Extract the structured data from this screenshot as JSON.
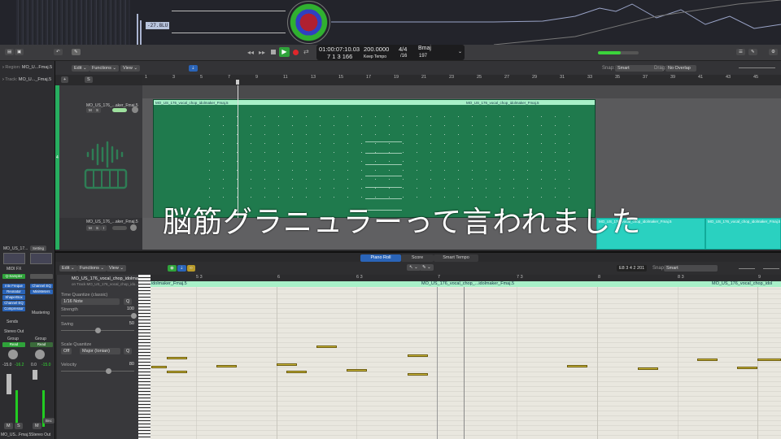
{
  "visualizer": {
    "loudness": "-27.8LU"
  },
  "transport": {
    "rewind": "rewind",
    "forward": "fast-forward",
    "stop": "stop",
    "play": "play",
    "record": "record",
    "cycle": "cycle"
  },
  "lcd": {
    "time": "01:00:07:10.03",
    "bars": "7  1  3  166",
    "tempo": "200.0000",
    "tempo_mode": "Keep Tempo",
    "signature": "4/4",
    "division": "/16",
    "key": "Bmaj",
    "key_value": "197"
  },
  "inspector": {
    "region_label": "Region:",
    "region_name": "MO_U...Fmaj.5",
    "track_label": "Track:",
    "track_name": "MO_U..._Fmaj.5"
  },
  "tracks_toolbar": {
    "edit": "Edit",
    "functions": "Functions",
    "view": "View",
    "snap_label": "Snap:",
    "snap_value": "Smart",
    "drag_label": "Drag:",
    "drag_value": "No Overlap",
    "add": "+",
    "s": "S"
  },
  "ruler": [
    "1",
    "3",
    "5",
    "7",
    "9",
    "11",
    "13",
    "15",
    "17",
    "19",
    "21",
    "23",
    "25",
    "27",
    "29",
    "31",
    "33",
    "35",
    "37",
    "39",
    "41",
    "43",
    "45"
  ],
  "tracks": [
    {
      "number": "4",
      "name": "MO_US_176_...aker_Fmaj.5",
      "m": "M",
      "s": "S",
      "r": "R",
      "i": "I"
    },
    {
      "name": "MO_US_176_...aker_Fmaj.5",
      "m": "M",
      "s": "S",
      "r": "R",
      "i": "I"
    }
  ],
  "regions": {
    "main": "MO_US_176_vocal_chop_idolmaker_Fmaj.5",
    "main_repeat": "MO_US_176_vocal_chop_idolmaker_Fmaj.5",
    "cyan1": "MO_US_176_vocal_chop_idolmaker_Fmaj.5",
    "cyan2": "MO_US_176_vocal_chop_idolmaker_Fmaj.5"
  },
  "lyric": "脳筋グラニュラーって言われました",
  "mixer": {
    "strip1": {
      "name": "MO_US_17...",
      "midi_fx": "MIDI FX",
      "instrument": "Q-Sampler",
      "plugins": [
        "Intv Freque",
        "Reonator",
        "ShaperBox",
        "Channel EQ",
        "Compressor"
      ],
      "sends": "Sends",
      "output": "Stereo Out",
      "group": "Group",
      "automation": "Read",
      "vol": "-15.0",
      "peak": "-16.2",
      "m": "M",
      "s": "S",
      "footer": "MO_US...Fmaj.5"
    },
    "strip2": {
      "setting": "Setting",
      "plugins": [
        "Channel EQ",
        "MiniMeters"
      ],
      "mastering": "Mastering",
      "group": "Group",
      "automation": "Read",
      "vol": "0.0",
      "peak": "-15.0",
      "bnc": "Bnc",
      "m": "M",
      "footer": "Stereo Out"
    }
  },
  "editor": {
    "tabs": [
      "Piano Roll",
      "Score",
      "Smart Tempo"
    ],
    "edit": "Edit",
    "functions": "Functions",
    "view": "View",
    "position": "E8   3 4 2 201",
    "snap_label": "Snap:",
    "snap_value": "Smart",
    "region_title": "MO_US_176_vocal_chop_idolma...",
    "region_sub": "on Track MO_US_176_vocal_chop_ido...",
    "ruler": [
      "5 3",
      "6",
      "6 3",
      "7",
      "7 3",
      "8",
      "8 3",
      "9"
    ],
    "region_label_left": "idolmaker_Fmaj.5",
    "region_label_mid": "MO_US_176_vocal_chop_...idolmaker_Fmaj.5",
    "region_label_right": "MO_US_176_vocal_chop_idol"
  },
  "quantize": {
    "title": "Time Quantize (classic)",
    "value": "1/16 Note",
    "q": "Q",
    "strength_label": "Strength",
    "strength": "100",
    "swing_label": "Swing",
    "swing": "50",
    "scale_title": "Scale Quantize",
    "scale_off": "Off",
    "scale": "Major (Ionian)",
    "velocity_label": "Velocity",
    "velocity": "80"
  }
}
